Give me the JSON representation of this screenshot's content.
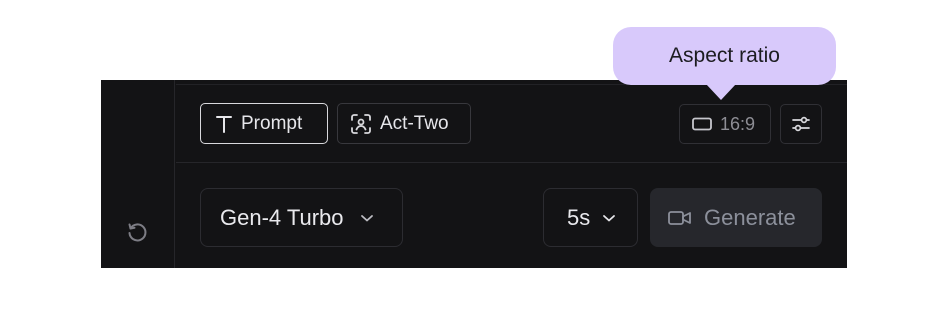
{
  "tooltip": {
    "text": "Aspect ratio"
  },
  "modes": [
    {
      "label": "Prompt",
      "icon": "text-t-icon",
      "selected": true
    },
    {
      "label": "Act-Two",
      "icon": "face-scan-icon",
      "selected": false
    }
  ],
  "aspect_ratio": {
    "value": "16:9",
    "icon": "rectangle-icon"
  },
  "settings": {
    "icon": "sliders-icon"
  },
  "model": {
    "label": "Gen-4 Turbo",
    "icon": "chevron-down-icon"
  },
  "duration": {
    "label": "5s",
    "icon": "chevron-down-icon"
  },
  "generate": {
    "label": "Generate",
    "icon": "video-camera-icon",
    "enabled": false
  },
  "reset": {
    "icon": "reset-icon"
  },
  "colors": {
    "panel": "#131315",
    "tooltip": "#d8c9fb",
    "generate_bg": "#26272c",
    "generate_text": "#8c909b"
  }
}
